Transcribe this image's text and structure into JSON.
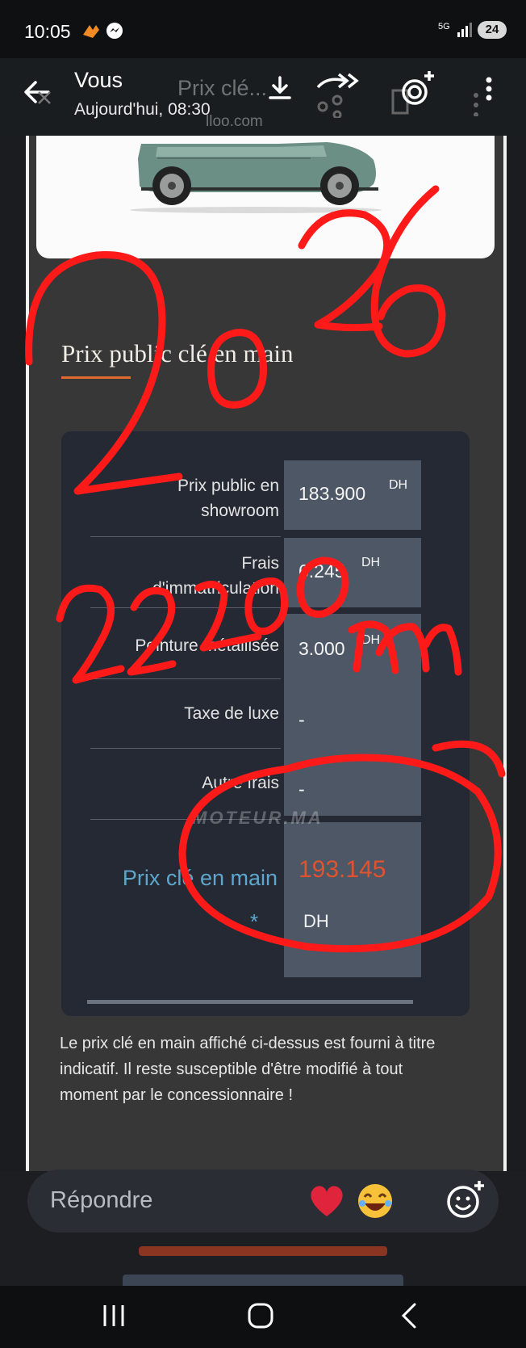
{
  "status_bar": {
    "time": "10:05",
    "battery": "24",
    "network": "5G"
  },
  "app_bar": {
    "sender": "Vous",
    "timestamp": "Aujourd'hui, 08:30",
    "underlying_title": "Prix clé...",
    "underlying_domain": "lloo.com"
  },
  "section": {
    "title": "Prix public clé en main"
  },
  "price_table": {
    "rows": [
      {
        "label": "Prix public en showroom",
        "value": "183.900",
        "unit": "DH"
      },
      {
        "label": "Frais d'immatriculation",
        "value": "6.245",
        "unit": "DH"
      },
      {
        "label": "Peinture métallisée",
        "value": "3.000",
        "unit": "DH"
      },
      {
        "label": "Taxe de luxe",
        "value": "-"
      },
      {
        "label": "Autre frais",
        "value": "-"
      }
    ],
    "total": {
      "label": "Prix clé en main",
      "star": "*",
      "value": "193.145",
      "unit": "DH"
    }
  },
  "watermark": "MOTEUR.MA",
  "disclaimer": "Le prix clé en main affiché ci-dessus est fourni à titre indicatif. Il reste susceptible d'être modifié à tout moment par le concessionnaire !",
  "reply": {
    "placeholder": "Répondre"
  },
  "colors": {
    "accent_orange": "#e06a2f",
    "total_blue": "#5fa6cc",
    "total_red": "#e0532f",
    "scribble_red": "#ff1a1a"
  }
}
